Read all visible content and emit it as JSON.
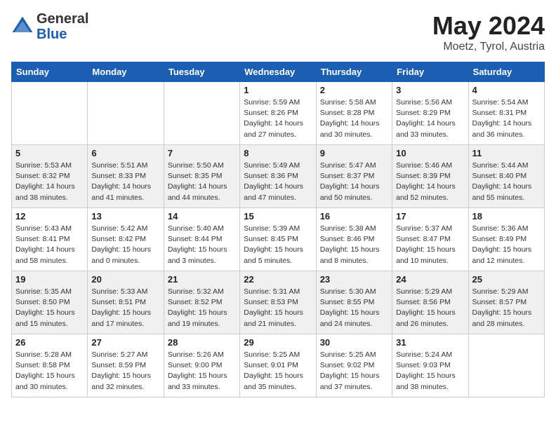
{
  "header": {
    "logo_general": "General",
    "logo_blue": "Blue",
    "month_title": "May 2024",
    "location": "Moetz, Tyrol, Austria"
  },
  "days_of_week": [
    "Sunday",
    "Monday",
    "Tuesday",
    "Wednesday",
    "Thursday",
    "Friday",
    "Saturday"
  ],
  "weeks": [
    [
      {
        "day": "",
        "info": ""
      },
      {
        "day": "",
        "info": ""
      },
      {
        "day": "",
        "info": ""
      },
      {
        "day": "1",
        "info": "Sunrise: 5:59 AM\nSunset: 8:26 PM\nDaylight: 14 hours\nand 27 minutes."
      },
      {
        "day": "2",
        "info": "Sunrise: 5:58 AM\nSunset: 8:28 PM\nDaylight: 14 hours\nand 30 minutes."
      },
      {
        "day": "3",
        "info": "Sunrise: 5:56 AM\nSunset: 8:29 PM\nDaylight: 14 hours\nand 33 minutes."
      },
      {
        "day": "4",
        "info": "Sunrise: 5:54 AM\nSunset: 8:31 PM\nDaylight: 14 hours\nand 36 minutes."
      }
    ],
    [
      {
        "day": "5",
        "info": "Sunrise: 5:53 AM\nSunset: 8:32 PM\nDaylight: 14 hours\nand 38 minutes."
      },
      {
        "day": "6",
        "info": "Sunrise: 5:51 AM\nSunset: 8:33 PM\nDaylight: 14 hours\nand 41 minutes."
      },
      {
        "day": "7",
        "info": "Sunrise: 5:50 AM\nSunset: 8:35 PM\nDaylight: 14 hours\nand 44 minutes."
      },
      {
        "day": "8",
        "info": "Sunrise: 5:49 AM\nSunset: 8:36 PM\nDaylight: 14 hours\nand 47 minutes."
      },
      {
        "day": "9",
        "info": "Sunrise: 5:47 AM\nSunset: 8:37 PM\nDaylight: 14 hours\nand 50 minutes."
      },
      {
        "day": "10",
        "info": "Sunrise: 5:46 AM\nSunset: 8:39 PM\nDaylight: 14 hours\nand 52 minutes."
      },
      {
        "day": "11",
        "info": "Sunrise: 5:44 AM\nSunset: 8:40 PM\nDaylight: 14 hours\nand 55 minutes."
      }
    ],
    [
      {
        "day": "12",
        "info": "Sunrise: 5:43 AM\nSunset: 8:41 PM\nDaylight: 14 hours\nand 58 minutes."
      },
      {
        "day": "13",
        "info": "Sunrise: 5:42 AM\nSunset: 8:42 PM\nDaylight: 15 hours\nand 0 minutes."
      },
      {
        "day": "14",
        "info": "Sunrise: 5:40 AM\nSunset: 8:44 PM\nDaylight: 15 hours\nand 3 minutes."
      },
      {
        "day": "15",
        "info": "Sunrise: 5:39 AM\nSunset: 8:45 PM\nDaylight: 15 hours\nand 5 minutes."
      },
      {
        "day": "16",
        "info": "Sunrise: 5:38 AM\nSunset: 8:46 PM\nDaylight: 15 hours\nand 8 minutes."
      },
      {
        "day": "17",
        "info": "Sunrise: 5:37 AM\nSunset: 8:47 PM\nDaylight: 15 hours\nand 10 minutes."
      },
      {
        "day": "18",
        "info": "Sunrise: 5:36 AM\nSunset: 8:49 PM\nDaylight: 15 hours\nand 12 minutes."
      }
    ],
    [
      {
        "day": "19",
        "info": "Sunrise: 5:35 AM\nSunset: 8:50 PM\nDaylight: 15 hours\nand 15 minutes."
      },
      {
        "day": "20",
        "info": "Sunrise: 5:33 AM\nSunset: 8:51 PM\nDaylight: 15 hours\nand 17 minutes."
      },
      {
        "day": "21",
        "info": "Sunrise: 5:32 AM\nSunset: 8:52 PM\nDaylight: 15 hours\nand 19 minutes."
      },
      {
        "day": "22",
        "info": "Sunrise: 5:31 AM\nSunset: 8:53 PM\nDaylight: 15 hours\nand 21 minutes."
      },
      {
        "day": "23",
        "info": "Sunrise: 5:30 AM\nSunset: 8:55 PM\nDaylight: 15 hours\nand 24 minutes."
      },
      {
        "day": "24",
        "info": "Sunrise: 5:29 AM\nSunset: 8:56 PM\nDaylight: 15 hours\nand 26 minutes."
      },
      {
        "day": "25",
        "info": "Sunrise: 5:29 AM\nSunset: 8:57 PM\nDaylight: 15 hours\nand 28 minutes."
      }
    ],
    [
      {
        "day": "26",
        "info": "Sunrise: 5:28 AM\nSunset: 8:58 PM\nDaylight: 15 hours\nand 30 minutes."
      },
      {
        "day": "27",
        "info": "Sunrise: 5:27 AM\nSunset: 8:59 PM\nDaylight: 15 hours\nand 32 minutes."
      },
      {
        "day": "28",
        "info": "Sunrise: 5:26 AM\nSunset: 9:00 PM\nDaylight: 15 hours\nand 33 minutes."
      },
      {
        "day": "29",
        "info": "Sunrise: 5:25 AM\nSunset: 9:01 PM\nDaylight: 15 hours\nand 35 minutes."
      },
      {
        "day": "30",
        "info": "Sunrise: 5:25 AM\nSunset: 9:02 PM\nDaylight: 15 hours\nand 37 minutes."
      },
      {
        "day": "31",
        "info": "Sunrise: 5:24 AM\nSunset: 9:03 PM\nDaylight: 15 hours\nand 38 minutes."
      },
      {
        "day": "",
        "info": ""
      }
    ]
  ]
}
